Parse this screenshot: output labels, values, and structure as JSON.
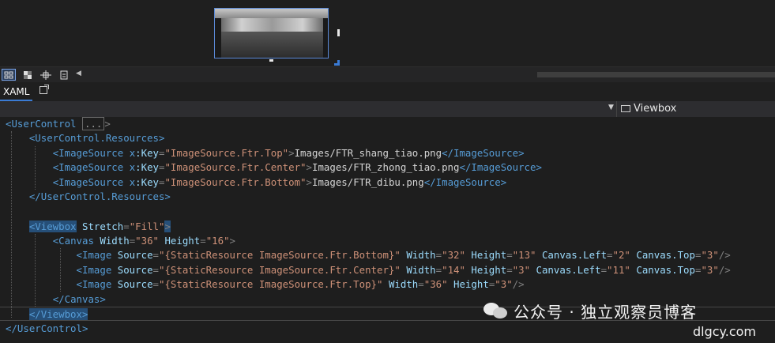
{
  "designer": {
    "preview_label": ""
  },
  "toolbar": {
    "buttons": [
      "grid-snap",
      "toggle-artboard",
      "snap-to-gridlines",
      "snap-to-snaplines"
    ]
  },
  "tabs": {
    "xaml_label": "XAML"
  },
  "nav": {
    "element_label": "Viewbox"
  },
  "code": {
    "l1_tag": "<UserControl",
    "l1_collapsed": "...",
    "l1_end": ">",
    "l2": "<UserControl.Resources>",
    "res_tag_open": "<ImageSource",
    "res_ns": "x",
    "res_attr": ":Key",
    "res1_key": "\"ImageSource.Ftr.Top\"",
    "res1_text": "Images/FTR_shang_tiao.png",
    "res2_key": "\"ImageSource.Ftr.Center\"",
    "res2_text": "Images/FTR_zhong_tiao.png",
    "res3_key": "\"ImageSource.Ftr.Bottom\"",
    "res3_text": "Images/FTR_dibu.png",
    "res_close": "</ImageSource>",
    "l6": "</UserControl.Resources>",
    "vb_tag": "<Viewbox",
    "vb_attr": "Stretch",
    "vb_val": "\"Fill\"",
    "cv_tag": "<Canvas",
    "cv_w_attr": "Width",
    "cv_w_val": "\"36\"",
    "cv_h_attr": "Height",
    "cv_h_val": "\"16\"",
    "img1": {
      "src": "\"{StaticResource ImageSource.Ftr.Bottom}\"",
      "w": "\"32\"",
      "h": "\"13\"",
      "left": "\"2\"",
      "top": "\"3\""
    },
    "img2": {
      "src": "\"{StaticResource ImageSource.Ftr.Center}\"",
      "w": "\"14\"",
      "h": "\"3\"",
      "left": "\"11\"",
      "top": "\"3\""
    },
    "img3": {
      "src": "\"{StaticResource ImageSource.Ftr.Top}\"",
      "w": "\"36\"",
      "h": "\"3\""
    },
    "cv_close": "</Canvas>",
    "vb_close": "</Viewbox>",
    "uc_close": "</UserControl>"
  },
  "watermark": {
    "text": "公众号 · 独立观察员博客",
    "url": "dlgcy.com"
  }
}
